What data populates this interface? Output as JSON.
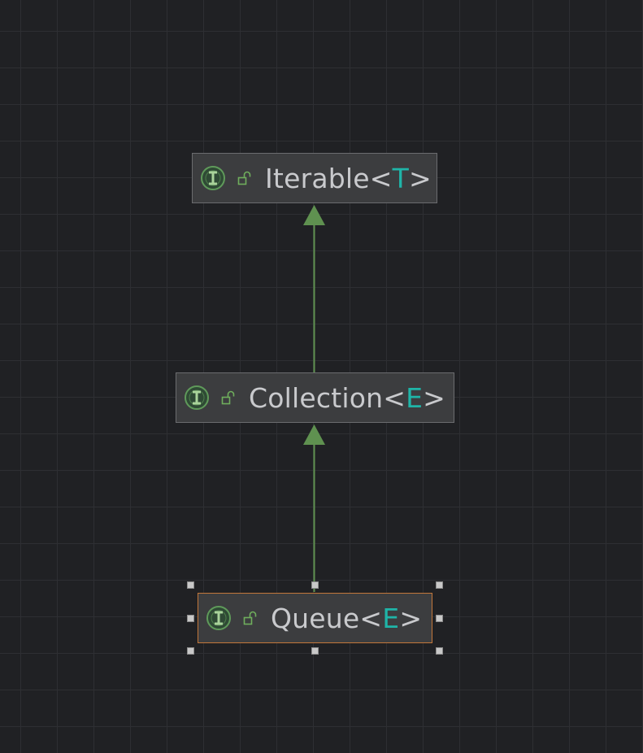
{
  "diagram": {
    "title": "",
    "colors": {
      "background": "#202124",
      "grid": "#2e2f33",
      "node_fill": "#3c3d3f",
      "node_border": "#6b6c6f",
      "selected_border": "#c2773a",
      "edge": "#5f9150",
      "type_param": "#1fb5a8",
      "text": "#c9cacd"
    },
    "nodes": [
      {
        "id": "iterable",
        "name": "Iterable",
        "open": "<",
        "type_param": "T",
        "close": ">",
        "kind_icon": "interface-icon",
        "visibility_icon": "public-unlock-icon",
        "selected": false
      },
      {
        "id": "collection",
        "name": "Collection",
        "open": "<",
        "type_param": "E",
        "close": ">",
        "kind_icon": "interface-icon",
        "visibility_icon": "public-unlock-icon",
        "selected": false
      },
      {
        "id": "queue",
        "name": "Queue",
        "open": "<",
        "type_param": "E",
        "close": ">",
        "kind_icon": "interface-icon",
        "visibility_icon": "public-unlock-icon",
        "selected": true
      }
    ],
    "edges": [
      {
        "from": "collection",
        "to": "iterable",
        "type": "extends"
      },
      {
        "from": "queue",
        "to": "collection",
        "type": "extends"
      }
    ]
  }
}
